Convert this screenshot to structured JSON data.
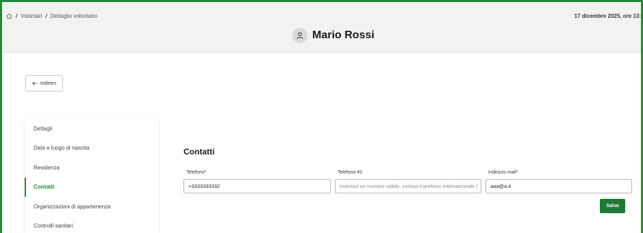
{
  "header": {
    "breadcrumb": [
      "Volontari",
      "Dettaglio volontario"
    ],
    "separator": "/",
    "datetime": "17 dicembre 2025, ore 13:",
    "title": "Mario Rossi"
  },
  "back_label": "Indietro",
  "sidebar": {
    "items": [
      {
        "label": "Dettagli"
      },
      {
        "label": "Data e luogo di nascita"
      },
      {
        "label": "Residenza"
      },
      {
        "label": "Contatti"
      },
      {
        "label": "Organizzazioni di appartenenza"
      },
      {
        "label": "Controlli sanitari"
      }
    ],
    "active": "Contatti"
  },
  "form": {
    "section_title": "Contatti",
    "phone_label": "Telefono",
    "phone_value": "+3333333332",
    "phone2_label": "Telefono #2",
    "phone2_placeholder": "Inserisci un numero valido, incluso il prefisso internazionale (",
    "email_label": "Indirizzo mail",
    "email_value": "aaa@a.it",
    "required_mark": "*",
    "save_label": "Salva"
  },
  "colors": {
    "accent": "#1f8a3b",
    "save_button": "#1f7a37"
  },
  "icons": [
    "home-icon",
    "user-icon",
    "arrow-left-icon"
  ]
}
